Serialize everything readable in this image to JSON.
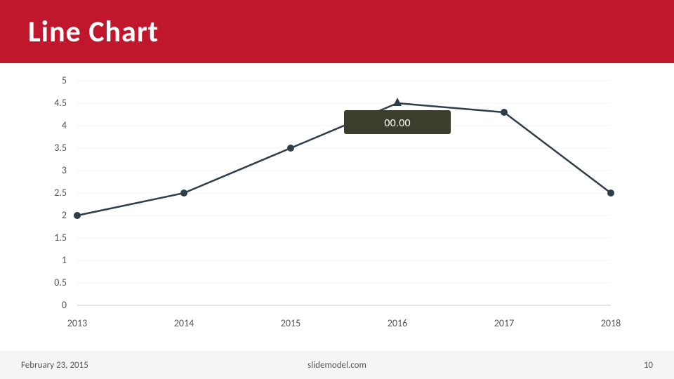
{
  "header": {
    "title": "Line Chart",
    "background_color": "#c0172d"
  },
  "footer": {
    "date": "February 23, 2015",
    "site": "slidemodel.com",
    "page": "10"
  },
  "chart": {
    "y_axis": {
      "min": 0,
      "max": 5,
      "ticks": [
        0,
        0.5,
        1,
        1.5,
        2,
        2.5,
        3,
        3.5,
        4,
        4.5,
        5
      ]
    },
    "x_axis": {
      "labels": [
        "2013",
        "2014",
        "2015",
        "2016",
        "2017",
        "2018"
      ]
    },
    "data_points": [
      {
        "year": "2013",
        "value": 2.0
      },
      {
        "year": "2014",
        "value": 2.5
      },
      {
        "year": "2015",
        "value": 3.5
      },
      {
        "year": "2016",
        "value": 4.5
      },
      {
        "year": "2017",
        "value": 4.3
      },
      {
        "year": "2018",
        "value": 2.5
      }
    ],
    "tooltip": {
      "visible": true,
      "value": "00.00",
      "target_year": "2016"
    },
    "line_color": "#2e3d4a",
    "dot_color": "#2e3d4a"
  }
}
